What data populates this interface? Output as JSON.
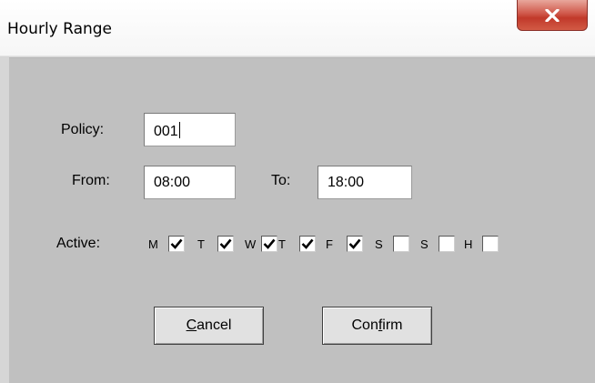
{
  "window": {
    "title": "Hourly Range",
    "close_icon": "close-x-icon"
  },
  "form": {
    "policy_label": "Policy:",
    "policy_value": "001",
    "from_label": "From:",
    "from_value": "08:00",
    "to_label": "To:",
    "to_value": "18:00",
    "active_label": "Active:",
    "days": [
      {
        "letter": "M",
        "checked": true
      },
      {
        "letter": "T",
        "checked": true
      },
      {
        "letter": "W",
        "checked": true
      },
      {
        "letter": "T",
        "checked": true
      },
      {
        "letter": "F",
        "checked": true
      },
      {
        "letter": "S",
        "checked": false
      },
      {
        "letter": "S",
        "checked": false
      },
      {
        "letter": "H",
        "checked": false
      }
    ]
  },
  "buttons": {
    "cancel_pre": "",
    "cancel_mnemonic": "C",
    "cancel_post": "ancel",
    "confirm_pre": "Con",
    "confirm_mnemonic": "f",
    "confirm_post": "irm"
  },
  "colors": {
    "dialog_bg": "#c0c0c0",
    "close_red": "#c1392a"
  }
}
